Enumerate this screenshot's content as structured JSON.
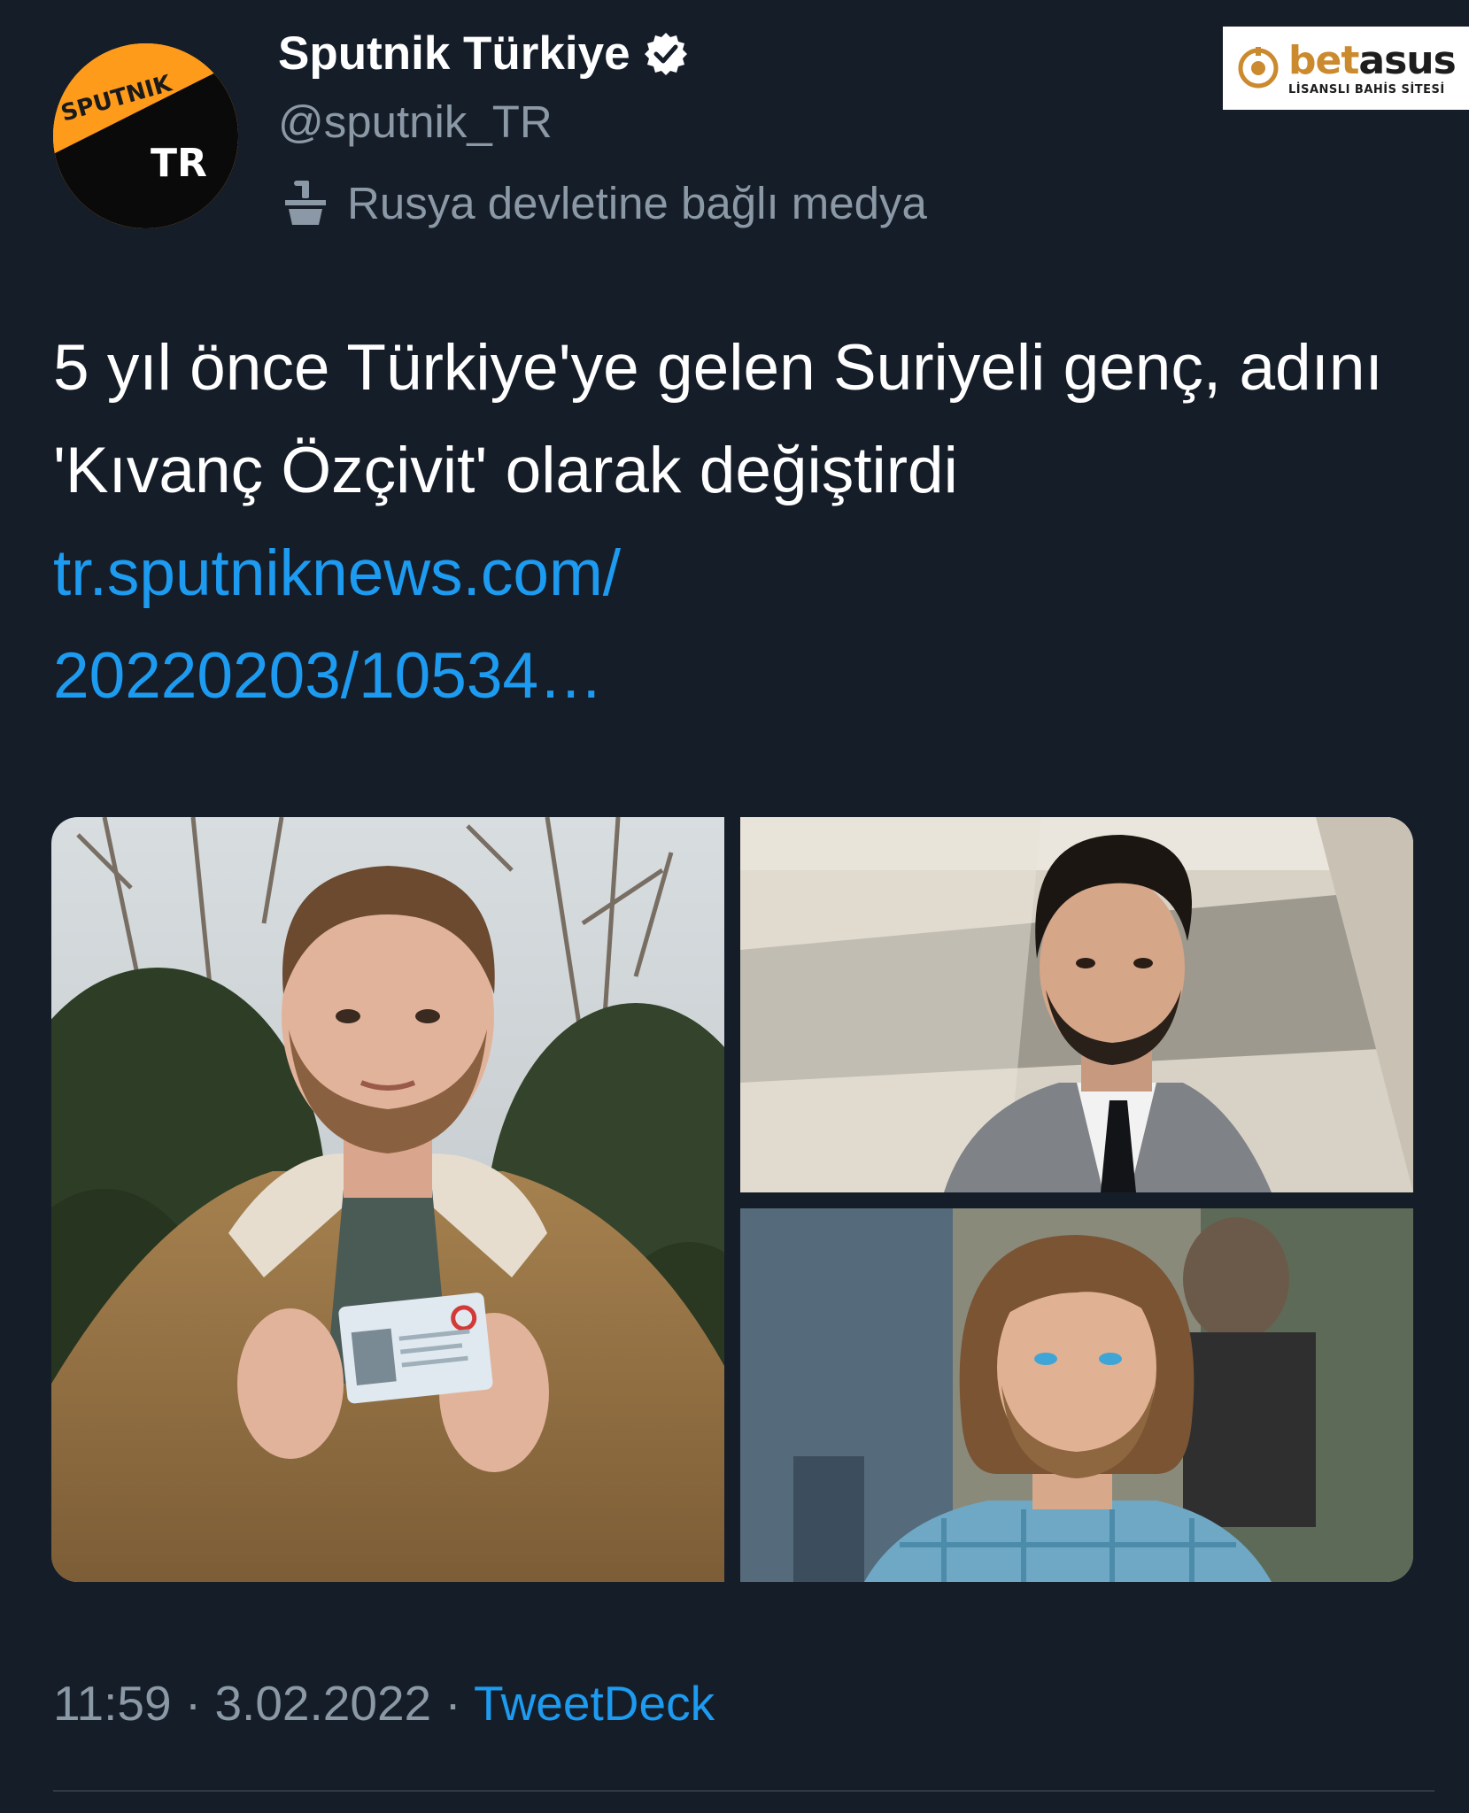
{
  "account": {
    "display_name": "Sputnik Türkiye",
    "handle": "@sputnik_TR",
    "state_media_label": "Rusya devletine bağlı medya",
    "avatar_text_top": "SPUTNIK",
    "avatar_text_bottom": "TR"
  },
  "watermark": {
    "brand_part1": "bet",
    "brand_part2": "asus",
    "tagline": "LİSANSLI BAHİS SİTESİ"
  },
  "tweet": {
    "text": "5 yıl önce Türkiye'ye gelen Suriyeli genç, adını 'Kıvanç Özçivit' olarak değiştirdi ",
    "link_text_line1": "tr.sputniknews.com/",
    "link_text_line2": "20220203/10534…",
    "time": "11:59",
    "separator": " · ",
    "date": "3.02.2022",
    "source": "TweetDeck"
  },
  "colors": {
    "background": "#151d29",
    "text_primary": "#ffffff",
    "text_secondary": "#8b98a5",
    "link": "#1d9bf0",
    "sputnik_orange": "#ff9b1a"
  },
  "icons": {
    "verified": "verified-badge-icon",
    "state_media": "podium-icon"
  }
}
